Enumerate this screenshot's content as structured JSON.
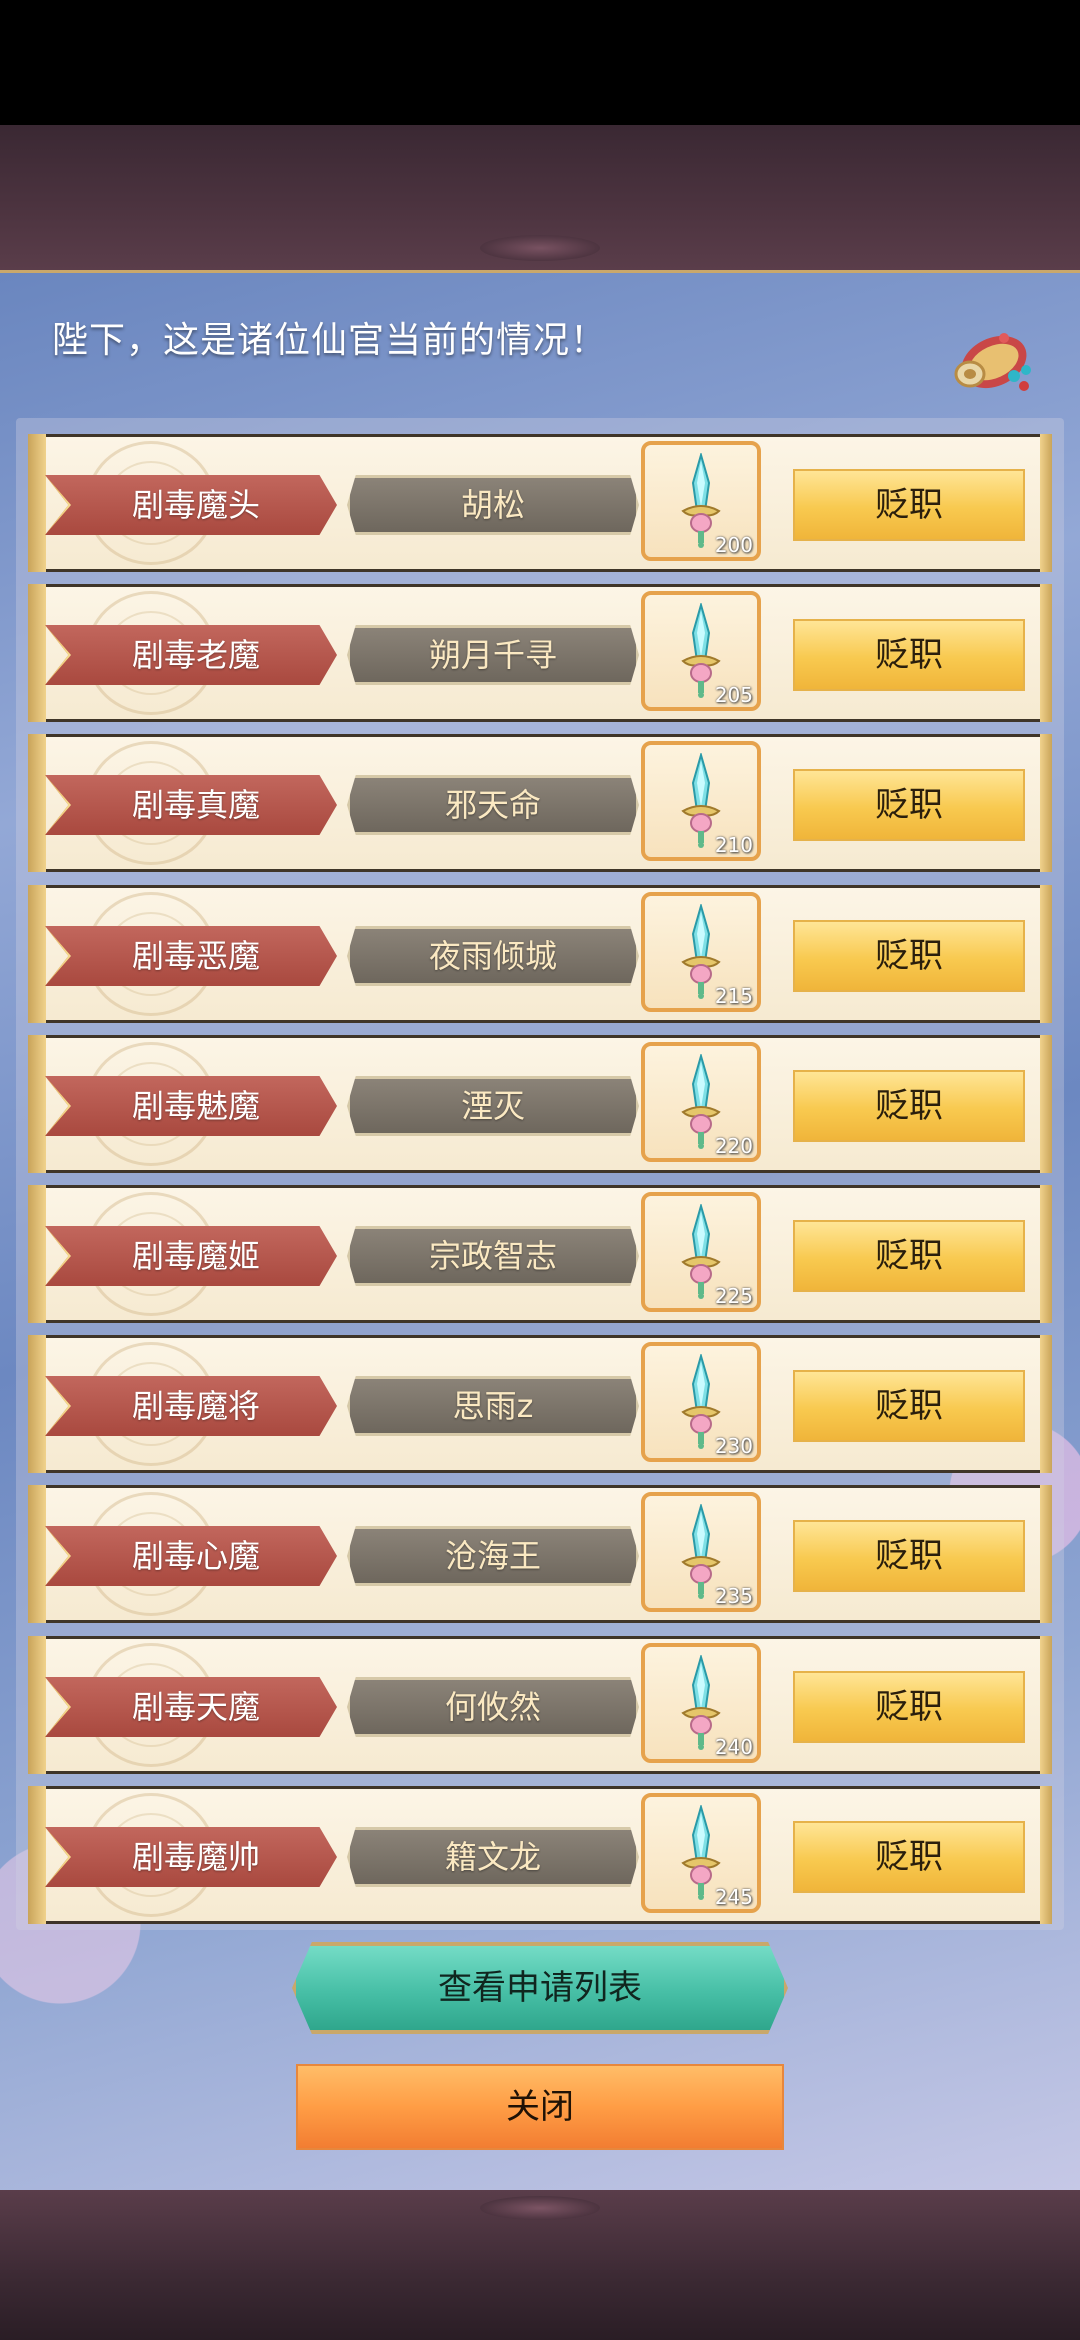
{
  "header": {
    "text": "陛下，这是诸位仙官当前的情况！"
  },
  "rows": [
    {
      "rank": "剧毒魔头",
      "name": "胡松",
      "item_level": "200",
      "action": "贬职"
    },
    {
      "rank": "剧毒老魔",
      "name": "朔月千寻",
      "item_level": "205",
      "action": "贬职"
    },
    {
      "rank": "剧毒真魔",
      "name": "邪天命",
      "item_level": "210",
      "action": "贬职"
    },
    {
      "rank": "剧毒恶魔",
      "name": "夜雨倾城",
      "item_level": "215",
      "action": "贬职"
    },
    {
      "rank": "剧毒魅魔",
      "name": "湮灭",
      "item_level": "220",
      "action": "贬职"
    },
    {
      "rank": "剧毒魔姬",
      "name": "宗政智志",
      "item_level": "225",
      "action": "贬职"
    },
    {
      "rank": "剧毒魔将",
      "name": "思雨z",
      "item_level": "230",
      "action": "贬职"
    },
    {
      "rank": "剧毒心魔",
      "name": "沧海王",
      "item_level": "235",
      "action": "贬职"
    },
    {
      "rank": "剧毒天魔",
      "name": "何攸然",
      "item_level": "240",
      "action": "贬职"
    },
    {
      "rank": "剧毒魔帅",
      "name": "籍文龙",
      "item_level": "245",
      "action": "贬职"
    }
  ],
  "buttons": {
    "apply_list": "查看申请列表",
    "close": "关闭"
  },
  "colors": {
    "rank_tag": "#b5564c",
    "name_plate": "#7b7469",
    "demote_button": "#f8c94f",
    "apply_button": "#47bfa6",
    "close_button": "#ff9d45",
    "item_border": "#e6a24c"
  },
  "icons": {
    "item": "sword-item-icon",
    "scroll": "scroll-icon"
  }
}
